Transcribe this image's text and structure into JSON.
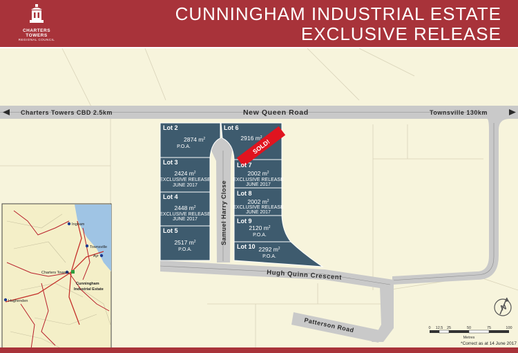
{
  "header": {
    "title_line1": "CUNNINGHAM INDUSTRIAL ESTATE",
    "title_line2": "EXCLUSIVE RELEASE",
    "logo_name": "CHARTERS TOWERS",
    "logo_sub": "REGIONAL COUNCIL"
  },
  "roads": {
    "new_queen": "New Queen Road",
    "cbd": "Charters Towers CBD 2.5km",
    "townsville": "Townsville 130km",
    "samuel": "Samuel Harry Close",
    "hugh": "Hugh Quinn Crescent",
    "patterson": "Patterson Road"
  },
  "lots": [
    {
      "name": "Lot 2",
      "size": "2874 m",
      "status": "P.O.A.",
      "status2": ""
    },
    {
      "name": "Lot 3",
      "size": "2424 m",
      "status": "EXCLUSIVE RELEASE",
      "status2": "JUNE 2017"
    },
    {
      "name": "Lot 4",
      "size": "2448 m",
      "status": "EXCLUSIVE RELEASE",
      "status2": "JUNE 2017"
    },
    {
      "name": "Lot 5",
      "size": "2517 m",
      "status": "P.O.A.",
      "status2": ""
    },
    {
      "name": "Lot 6",
      "size": "2916 m",
      "status": "",
      "status2": ""
    },
    {
      "name": "Lot 7",
      "size": "2002 m",
      "status": "EXCLUSIVE RELEASE",
      "status2": "JUNE 2017"
    },
    {
      "name": "Lot 8",
      "size": "2002 m",
      "status": "EXCLUSIVE RELEASE",
      "status2": "JUNE 2017"
    },
    {
      "name": "Lot 9",
      "size": "2120 m",
      "status": "P.O.A.",
      "status2": ""
    },
    {
      "name": "Lot 10",
      "size": "2292 m",
      "status": "P.O.A.",
      "status2": ""
    }
  ],
  "superscript": "2",
  "sold_label": "SOLD!",
  "inset": {
    "ingham": "Ingham",
    "townsville": "Townsville",
    "ayr": "Ayr",
    "charters": "Charters Towers",
    "estate1": "Cunningham",
    "estate2": "Industrial Estate",
    "hughenden": "Hughenden"
  },
  "scale": {
    "ticks": [
      "0",
      "12.5",
      "25",
      "50",
      "75",
      "100"
    ],
    "unit": "Metres"
  },
  "note": "*Correct as at 14 June 2017",
  "compass": "N",
  "colors": {
    "header": "#a8333a",
    "lot": "#3e5b6e",
    "road": "#c9c9c9",
    "background": "#f7f4dc",
    "sold": "#e0141f"
  }
}
